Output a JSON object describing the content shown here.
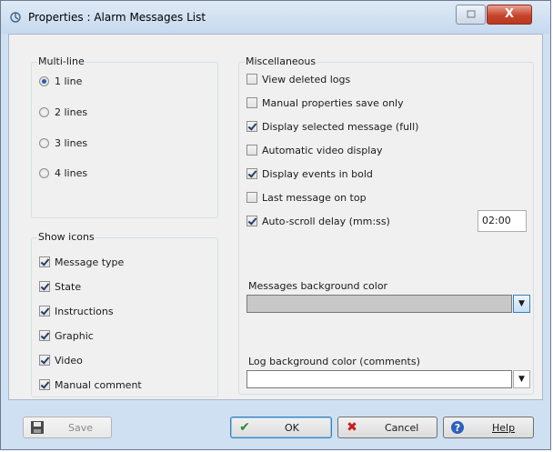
{
  "window": {
    "title": "Properties : Alarm Messages List",
    "close_label": "X"
  },
  "multiline": {
    "title": "Multi-line",
    "options": [
      {
        "label": "1 line",
        "selected": true
      },
      {
        "label": "2 lines",
        "selected": false
      },
      {
        "label": "3 lines",
        "selected": false
      },
      {
        "label": "4 lines",
        "selected": false
      }
    ]
  },
  "show_icons": {
    "title": "Show icons",
    "items": [
      {
        "label": "Message type",
        "checked": true
      },
      {
        "label": "State",
        "checked": true
      },
      {
        "label": "Instructions",
        "checked": true
      },
      {
        "label": "Graphic",
        "checked": true
      },
      {
        "label": "Video",
        "checked": true
      },
      {
        "label": "Manual comment",
        "checked": true
      }
    ]
  },
  "misc": {
    "title": "Miscellaneous",
    "items": [
      {
        "label": "View deleted logs",
        "checked": false
      },
      {
        "label": "Manual properties save only",
        "checked": false
      },
      {
        "label": "Display selected message (full)",
        "checked": true
      },
      {
        "label": "Automatic video display",
        "checked": false
      },
      {
        "label": "Display events in bold",
        "checked": true
      },
      {
        "label": "Last message on top",
        "checked": false
      },
      {
        "label": "Auto-scroll delay (mm:ss)",
        "checked": true
      }
    ],
    "autoscroll_value": "02:00",
    "msg_bg_label": "Messages background color",
    "msg_bg_color": "#c8c8c8",
    "log_bg_label": "Log background color (comments)",
    "log_bg_color": "#ffffff"
  },
  "buttons": {
    "save": "Save",
    "ok": "OK",
    "cancel": "Cancel",
    "help": "Help"
  },
  "icons": {
    "save": "floppy-disk-icon",
    "ok": "check-icon",
    "cancel": "x-icon",
    "help": "question-icon"
  },
  "colors": {
    "ok_icon": "#2a8a2a",
    "cancel_icon": "#cc1a1a",
    "help_icon": "#2d5fc0"
  }
}
